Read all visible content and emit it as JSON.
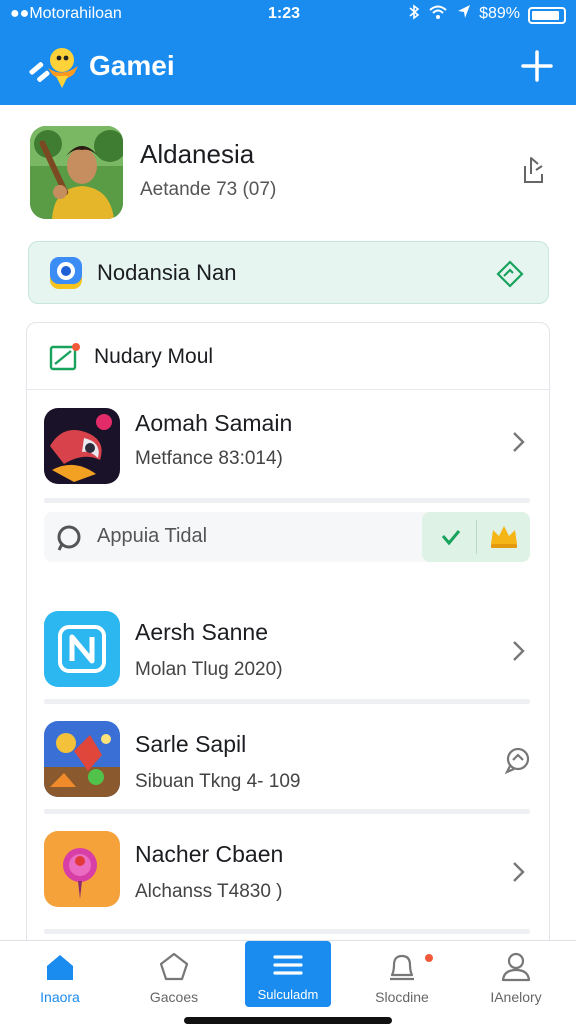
{
  "status_bar": {
    "carrier": "●●Motorahiloan",
    "time": "1:23",
    "battery_pct": "89%",
    "battery_level": 0.8
  },
  "header": {
    "title": "Gamei"
  },
  "profile": {
    "name": "Aldanesia",
    "subtitle": "Aetande  73 (07)"
  },
  "banner": {
    "text": "Nodansia Nan"
  },
  "card": {
    "title": "Nudary Moul",
    "search_placeholder": "Appuia Tidal",
    "items": [
      {
        "title": "Aomah Samain",
        "subtitle": "Metfance  83:014)"
      },
      {
        "title": "Aersh Sanne",
        "subtitle": "Molan  Tlug 2020)"
      },
      {
        "title": "Sarle Sapil",
        "subtitle": "Sibuan  Tkng 4- 109"
      },
      {
        "title": "Nacher Cbaen",
        "subtitle": "Alchanss  T4830 )"
      }
    ]
  },
  "bottom_nav": {
    "tabs": [
      {
        "label": "Inaora",
        "icon": "home-icon"
      },
      {
        "label": "Gacoes",
        "icon": "pentagon-icon"
      },
      {
        "label": "Sulculadm",
        "icon": "menu-icon"
      },
      {
        "label": "Slocdine",
        "icon": "bell-icon"
      },
      {
        "label": "IAnelory",
        "icon": "person-icon"
      }
    ]
  },
  "colors": {
    "brand": "#1a8cf0",
    "banner_bg": "#e7f5f0",
    "badge": "#f05a3a"
  }
}
